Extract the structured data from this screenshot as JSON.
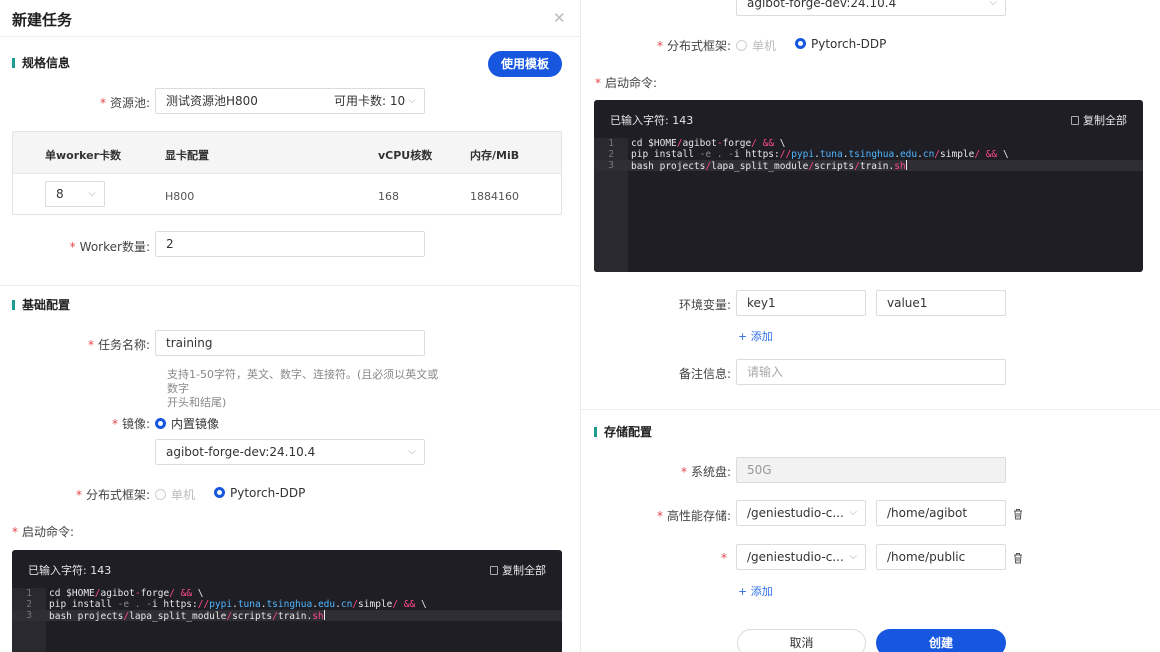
{
  "dialog": {
    "title": "新建任务",
    "close_icon": "close-icon"
  },
  "spec": {
    "section_title": "规格信息",
    "template_button": "使用模板",
    "pool_label": "资源池:",
    "pool_value": "测试资源池H800",
    "pool_available": "可用卡数: 10",
    "table": {
      "headers": [
        "单worker卡数",
        "显卡配置",
        "vCPU核数",
        "内存/MiB"
      ],
      "row": {
        "cards": "8",
        "gpu": "H800",
        "vcpu": "168",
        "memory": "1884160"
      }
    },
    "worker_label": "Worker数量:",
    "worker_value": "2"
  },
  "basic": {
    "section_title": "基础配置",
    "task_name_label": "任务名称:",
    "task_name_value": "training",
    "task_name_hint_line1": "支持1-50字符，英文、数字、连接符。(且必须以英文或数字",
    "task_name_hint_line2": "开头和结尾)",
    "image_label": "镜像:",
    "image_type": "内置镜像",
    "image_value": "agibot-forge-dev:24.10.4",
    "framework_label": "分布式框架:",
    "framework_options": [
      "单机",
      "Pytorch-DDP"
    ],
    "command_label": "启动命令:",
    "char_count": "已输入字符: 143",
    "copy_all": "复制全部",
    "code": {
      "line_numbers": [
        "1",
        "2",
        "3"
      ],
      "line1": {
        "a": "cd $HOME",
        "s1": "/",
        "b": "agibot",
        "s2": "-",
        "c": "forge",
        "s3": "/ &&",
        "d": " \\"
      },
      "line2": {
        "a": "pip install",
        "s1": " -e . -",
        "b": "i https:",
        "s2": "//",
        "c": "pypi",
        "s3": ".",
        "d": "tuna",
        "s4": ".",
        "e": "tsinghua",
        "s5": ".",
        "f": "edu",
        "s6": ".",
        "g": "cn",
        "s7": "/",
        "h": "simple",
        "s8": "/ &&",
        "i": " \\"
      },
      "line3": {
        "a": "bash projects",
        "s1": "/",
        "b": "lapa_split_module",
        "s2": "/",
        "c": "scripts",
        "s3": "/",
        "d": "train",
        "s4": ".",
        "e": "sh"
      }
    }
  },
  "right": {
    "image_value_top": "agibot-forge-dev:24.10.4",
    "env_label": "环境变量:",
    "env_key": "key1",
    "env_value": "value1",
    "add_label": "+ 添加",
    "note_label": "备注信息:",
    "note_placeholder": "请输入",
    "storage_title": "存储配置",
    "sys_disk_label": "系统盘:",
    "sys_disk_value": "50G",
    "hp_storage_label": "高性能存储:",
    "storage_rows": [
      {
        "source": "/geniestudio-c...",
        "path": "/home/agibot"
      },
      {
        "source": "/geniestudio-c...",
        "path": "/home/public"
      }
    ],
    "cancel_button": "取消",
    "create_button": "创建"
  },
  "colors": {
    "primary": "#1757e0",
    "accent_bar": "#1a9c8e",
    "required": "#e5484d",
    "code_bg": "#1f1e24"
  }
}
